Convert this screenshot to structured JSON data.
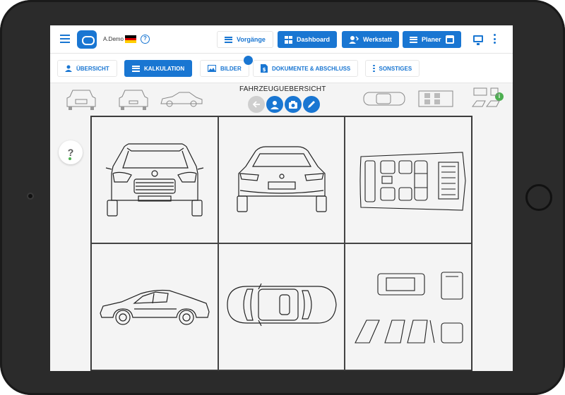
{
  "header": {
    "user": "A.Demo",
    "buttons": {
      "vorgaenge": "Vorgänge",
      "dashboard": "Dashboard",
      "werkstatt": "Werkstatt",
      "planer": "Planer"
    }
  },
  "tabs": {
    "uebersicht": "ÜBERSICHT",
    "kalkulation": "KALKULATION",
    "bilder": "BILDER",
    "dokumente": "DOKUMENTE & ABSCHLUSS",
    "sonstiges": "SONSTIGES"
  },
  "status": {
    "info": "i"
  },
  "content": {
    "title": "FAHRZEUGUEBERSICHT",
    "help": "?"
  },
  "colors": {
    "accent": "#1976d2",
    "status": "#4caf50"
  },
  "icons": {
    "menu": "menu-icon",
    "logo": "cloud-logo-icon",
    "help": "help-icon",
    "monitor": "monitor-icon",
    "more": "more-vert-icon",
    "back": "back-arrow-icon",
    "person": "person-icon",
    "camera": "camera-icon",
    "edit": "pencil-icon"
  }
}
